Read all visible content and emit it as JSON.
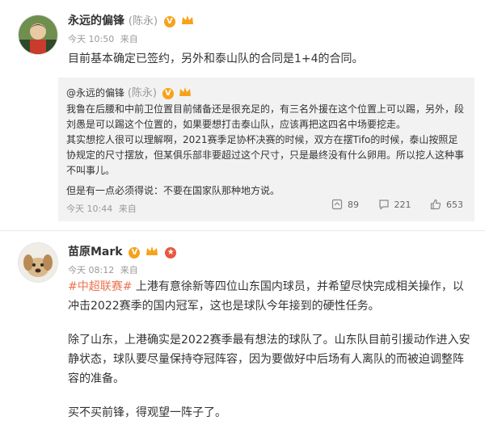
{
  "post1": {
    "username": "永远的偏锋",
    "alias": "(陈永)",
    "meta": {
      "time": "今天 10:50",
      "source": "来自"
    },
    "text": "目前基本确定已签约，另外和泰山队的合同是1+4的合同。",
    "quote": {
      "username": "@永远的偏锋",
      "alias": "(陈永)",
      "paragraphs": [
        "我鲁在后腰和中前卫位置目前储备还是很充足的，有三名外援在这个位置上可以踢，另外，段刘愚是可以踢这个位置的，如果要想打击泰山队，应该再把这四名中场要挖走。",
        "其实想挖人很可以理解啊，2021赛季足协杯决赛的时候，双方在摆Tifo的时候，泰山按照足协规定的尺寸摆放，但某俱乐部非要超过这个尺寸，只是最终没有什么卵用。所以挖人这种事不叫事儿。",
        "但是有一点必须得说：不要在国家队那种地方说。"
      ],
      "meta": {
        "time": "今天 10:44",
        "source": "来自"
      },
      "stats": {
        "reposts": "89",
        "comments": "221",
        "likes": "653"
      }
    }
  },
  "post2": {
    "username": "苗原Mark",
    "meta": {
      "time": "今天 08:12",
      "source": "来自"
    },
    "hashtag": "#中超联赛#",
    "paragraph1": " 上港有意徐新等四位山东国内球员，并希望尽快完成相关操作，以冲击2022赛季的国内冠军，这也是球队今年接到的硬性任务。",
    "paragraph2": "除了山东，上港确实是2022赛季最有想法的球队了。山东队目前引援动作进入安静状态，球队要尽量保持夺冠阵容，因为要做好中后场有人离队的而被迫调整阵容的准备。",
    "paragraph3": "买不买前锋，得观望一阵子了。"
  },
  "colors": {
    "hashtag": "#eb7350",
    "vip_badge": "#f7a21b",
    "quote_bg": "#f2f2f2"
  }
}
